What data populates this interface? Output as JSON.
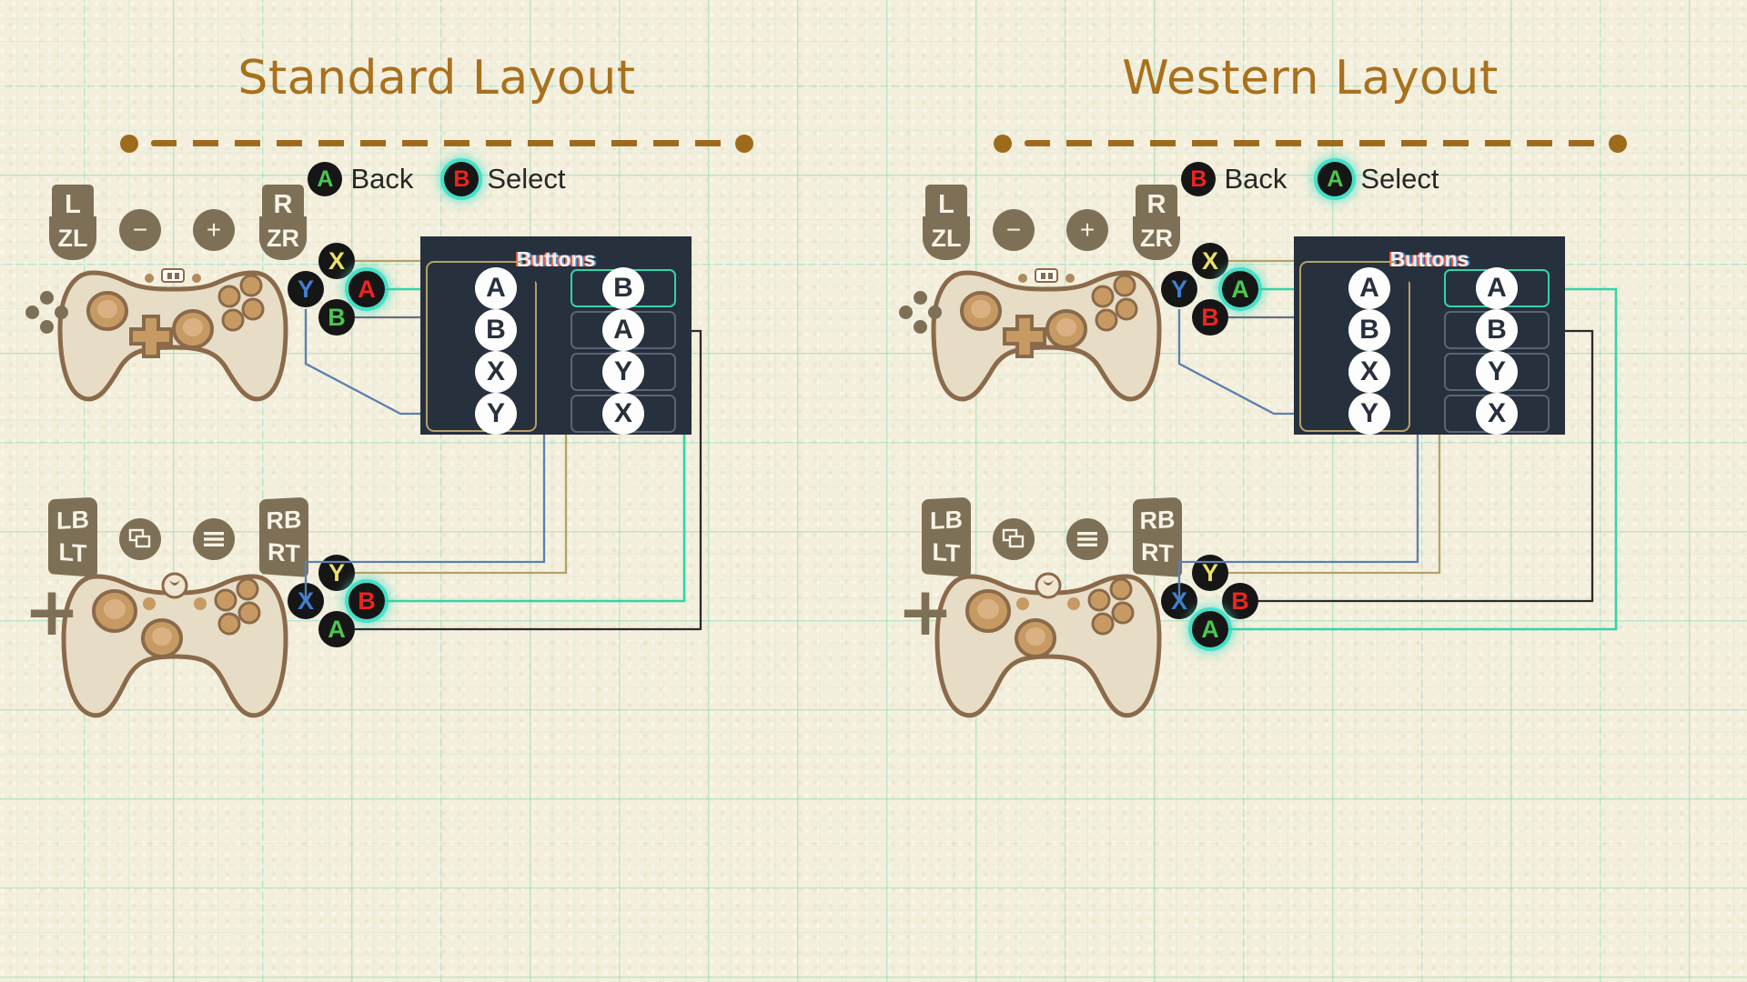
{
  "page": {
    "background_color": "#f4efdc",
    "grid_color": "#7cd8b4",
    "title_color": "#a9701d",
    "panel_color": "#27303d",
    "highlight_color": "#2fd6a8",
    "accent_brown": "#7e7056"
  },
  "layouts": [
    {
      "id": "standard",
      "title": "Standard Layout",
      "legend": [
        {
          "button": "A",
          "button_color": "#4ec552",
          "label": "Back",
          "highlighted": false
        },
        {
          "button": "B",
          "button_color": "#f0231f",
          "label": "Select",
          "highlighted": true
        }
      ],
      "nintendo_controller": {
        "name": "Nintendo Switch Pro Controller",
        "shoulder_left": [
          "L",
          "ZL"
        ],
        "shoulder_right": [
          "R",
          "ZR"
        ],
        "minus_label": "−",
        "plus_label": "+",
        "face_buttons": [
          {
            "label": "X",
            "color": "#ece06a",
            "highlighted": false
          },
          {
            "label": "Y",
            "color": "#3f7fd4",
            "highlighted": false
          },
          {
            "label": "A",
            "color": "#f0231f",
            "highlighted": true
          },
          {
            "label": "B",
            "color": "#4ec552",
            "highlighted": false
          }
        ]
      },
      "xbox_controller": {
        "name": "Xbox Controller",
        "shoulder_left": [
          "LB",
          "LT"
        ],
        "shoulder_right": [
          "RB",
          "RT"
        ],
        "view_icon": "windows-icon",
        "menu_icon": "hamburger-icon",
        "face_buttons": [
          {
            "label": "Y",
            "color": "#ece06a",
            "highlighted": false
          },
          {
            "label": "X",
            "color": "#3f7fd4",
            "highlighted": false
          },
          {
            "label": "B",
            "color": "#f0231f",
            "highlighted": true
          },
          {
            "label": "A",
            "color": "#4ec552",
            "highlighted": false
          }
        ]
      },
      "panel": {
        "title": "Buttons",
        "left_column": [
          "A",
          "B",
          "X",
          "Y"
        ],
        "right_column": [
          "B",
          "A",
          "Y",
          "X"
        ],
        "selected_index": 0
      }
    },
    {
      "id": "western",
      "title": "Western Layout",
      "legend": [
        {
          "button": "B",
          "button_color": "#f0231f",
          "label": "Back",
          "highlighted": false
        },
        {
          "button": "A",
          "button_color": "#4ec552",
          "label": "Select",
          "highlighted": true
        }
      ],
      "nintendo_controller": {
        "name": "Nintendo Switch Pro Controller",
        "shoulder_left": [
          "L",
          "ZL"
        ],
        "shoulder_right": [
          "R",
          "ZR"
        ],
        "minus_label": "−",
        "plus_label": "+",
        "face_buttons": [
          {
            "label": "X",
            "color": "#ece06a",
            "highlighted": false
          },
          {
            "label": "Y",
            "color": "#3f7fd4",
            "highlighted": false
          },
          {
            "label": "A",
            "color": "#4ec552",
            "highlighted": true
          },
          {
            "label": "B",
            "color": "#f0231f",
            "highlighted": false
          }
        ]
      },
      "xbox_controller": {
        "name": "Xbox Controller",
        "shoulder_left": [
          "LB",
          "LT"
        ],
        "shoulder_right": [
          "RB",
          "RT"
        ],
        "view_icon": "windows-icon",
        "menu_icon": "hamburger-icon",
        "face_buttons": [
          {
            "label": "Y",
            "color": "#ece06a",
            "highlighted": false
          },
          {
            "label": "X",
            "color": "#3f7fd4",
            "highlighted": false
          },
          {
            "label": "B",
            "color": "#f0231f",
            "highlighted": false
          },
          {
            "label": "A",
            "color": "#4ec552",
            "highlighted": true
          }
        ]
      },
      "panel": {
        "title": "Buttons",
        "left_column": [
          "A",
          "B",
          "X",
          "Y"
        ],
        "right_column": [
          "A",
          "B",
          "Y",
          "X"
        ],
        "selected_index": 0
      }
    }
  ]
}
